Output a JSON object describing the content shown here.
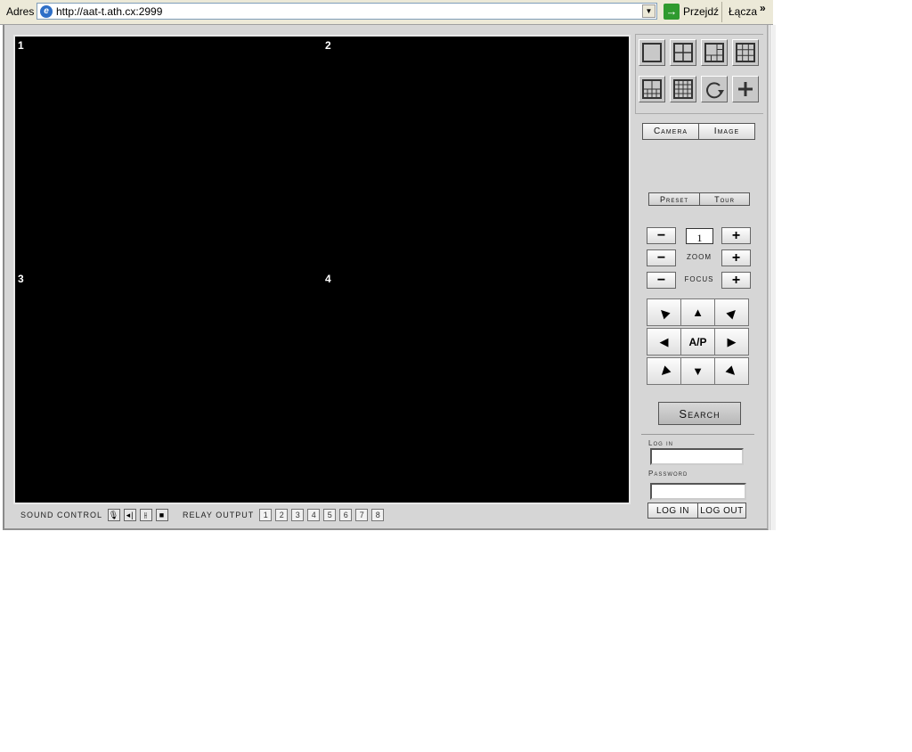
{
  "browser": {
    "address_label": "Adres",
    "url": "http://aat-t.ath.cx:2999",
    "go_label": "Przejdź",
    "links_label": "Łącza",
    "more_chevron": "»"
  },
  "video": {
    "channels": [
      "1",
      "2",
      "3",
      "4"
    ]
  },
  "bottom": {
    "sound_label": "SOUND CONTROL",
    "sound_buttons": [
      "microphone-icon",
      "speaker-icon",
      "mute-icon",
      "stop-icon"
    ],
    "relay_label": "RELAY OUTPUT",
    "relay_buttons": [
      "1",
      "2",
      "3",
      "4",
      "5",
      "6",
      "7",
      "8"
    ]
  },
  "panel": {
    "layout_buttons": [
      "layout-1x1",
      "layout-2x2",
      "layout-1-plus-5",
      "layout-3x3",
      "layout-1-plus-7",
      "layout-4x4",
      "rotate",
      "add"
    ],
    "camera_tab": "Camera",
    "image_tab": "Image",
    "preset_btn": "Preset",
    "tour_btn": "Tour",
    "minus": "−",
    "plus": "+",
    "speed_value": "1",
    "zoom_label": "ZOOM",
    "focus_label": "FOCUS",
    "ptz_center": "A/P",
    "search_btn": "Search",
    "login_label": "Log in",
    "login_value": "",
    "password_label": "Password",
    "password_value": "",
    "login_btn": "LOG IN",
    "logout_btn": "LOG OUT"
  }
}
